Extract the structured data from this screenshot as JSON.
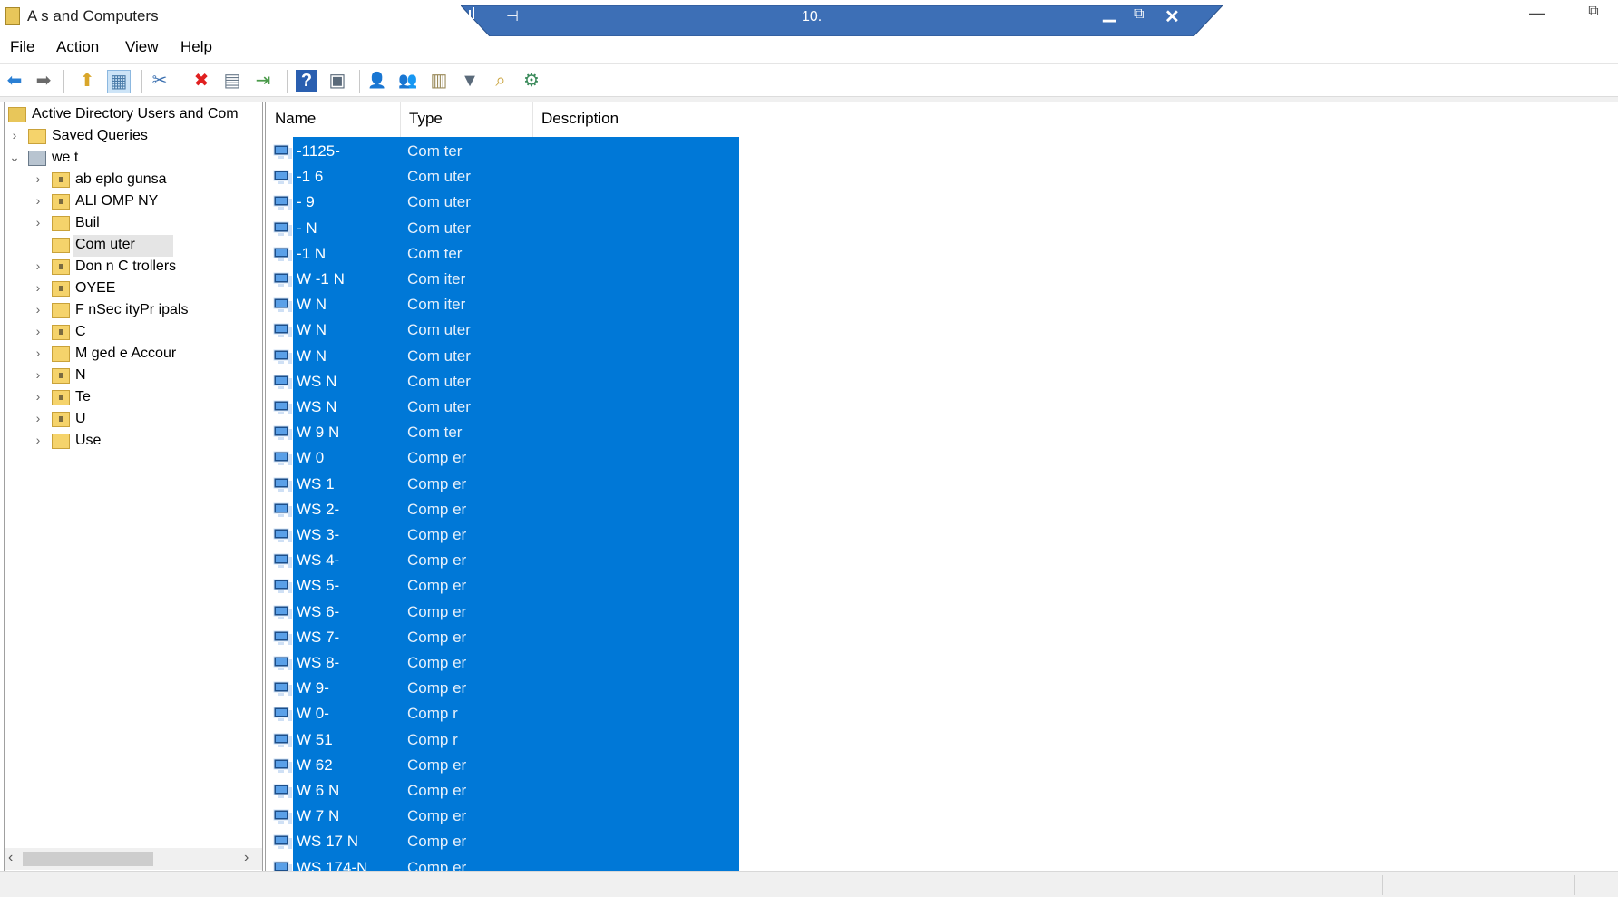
{
  "window": {
    "title": "A          s and Computers",
    "min_glyph": "—",
    "restore_glyph": "⧉"
  },
  "rdp_bar": {
    "title": "10.",
    "pin_glyph": "⊣",
    "min_glyph": "▁",
    "restore_glyph": "⧉",
    "close_glyph": "✕",
    "color": "#3d6fb6"
  },
  "menu": {
    "file": "File",
    "action": "Action",
    "view": "View",
    "help": "Help"
  },
  "toolbar": {
    "back_glyph": "⬅",
    "forward_glyph": "➡",
    "up_glyph": "⬆",
    "show_tree_glyph": "▦",
    "cut_glyph": "✂",
    "delete_glyph": "✖",
    "properties_glyph": "▤",
    "export_glyph": "⇥",
    "help_glyph": "?",
    "console_glyph": "▣",
    "new_user_glyph": "👤",
    "new_group_glyph": "👥",
    "new_ou_glyph": "▥",
    "filter_glyph": "▼",
    "find_glyph": "⌕",
    "add_to_group_glyph": "⚙"
  },
  "tree": {
    "root": "Active Directory Users and Com",
    "expand_glyph": "›",
    "collapse_glyph": "⌄",
    "items": [
      {
        "label": "Saved Queries"
      },
      {
        "label": "we      t"
      },
      {
        "label": "ab  eplo  gunsa"
      },
      {
        "label": "ALI  OMP  NY"
      },
      {
        "label": "Buil"
      },
      {
        "label": "Com  uter"
      },
      {
        "label": "Don   n C   trollers"
      },
      {
        "label": "     OYEE"
      },
      {
        "label": "F    nSec  ityPr   ipals"
      },
      {
        "label": "C"
      },
      {
        "label": "M     ged       e Accour"
      },
      {
        "label": "N"
      },
      {
        "label": "Te"
      },
      {
        "label": "U"
      },
      {
        "label": "Use"
      }
    ],
    "scroll_left": "‹",
    "scroll_right": "›"
  },
  "list": {
    "columns": {
      "name": "Name",
      "type": "Type",
      "description": "Description"
    },
    "selection_color": "#0078d7",
    "rows": [
      {
        "name": "  -1125-",
        "type": "Com   ter"
      },
      {
        "name": "   -1   6",
        "type": "Com   uter"
      },
      {
        "name": "   -    9",
        "type": "Com   uter"
      },
      {
        "name": "   -     N",
        "type": "Com   uter"
      },
      {
        "name": "   -1    N",
        "type": "Com   ter"
      },
      {
        "name": "W   -1    N",
        "type": "Com   iter"
      },
      {
        "name": "W        N",
        "type": "Com   iter"
      },
      {
        "name": "W        N",
        "type": "Com   uter"
      },
      {
        "name": "W        N",
        "type": "Com   uter"
      },
      {
        "name": "WS       N",
        "type": "Com   uter"
      },
      {
        "name": "WS       N",
        "type": "Com   uter"
      },
      {
        "name": "W      9   N",
        "type": "Com   ter"
      },
      {
        "name": "W      0",
        "type": "Comp   er"
      },
      {
        "name": "WS      1",
        "type": "Comp   er"
      },
      {
        "name": "WS     2-",
        "type": "Comp   er"
      },
      {
        "name": "WS     3-",
        "type": "Comp   er"
      },
      {
        "name": "WS     4-",
        "type": "Comp   er"
      },
      {
        "name": "WS     5-",
        "type": "Comp   er"
      },
      {
        "name": "WS     6-",
        "type": "Comp   er"
      },
      {
        "name": "WS     7-",
        "type": "Comp   er"
      },
      {
        "name": "WS     8-",
        "type": "Comp   er"
      },
      {
        "name": "W      9-",
        "type": "Comp   er"
      },
      {
        "name": "W      0-",
        "type": "Comp   r"
      },
      {
        "name": "W     51",
        "type": "Comp   r"
      },
      {
        "name": "W     62",
        "type": "Comp   er"
      },
      {
        "name": "W     6   N",
        "type": "Comp   er"
      },
      {
        "name": "W     7   N",
        "type": "Comp   er"
      },
      {
        "name": "WS   17   N",
        "type": "Comp   er"
      },
      {
        "name": "WS   174-N",
        "type": "Comp   er"
      }
    ]
  }
}
